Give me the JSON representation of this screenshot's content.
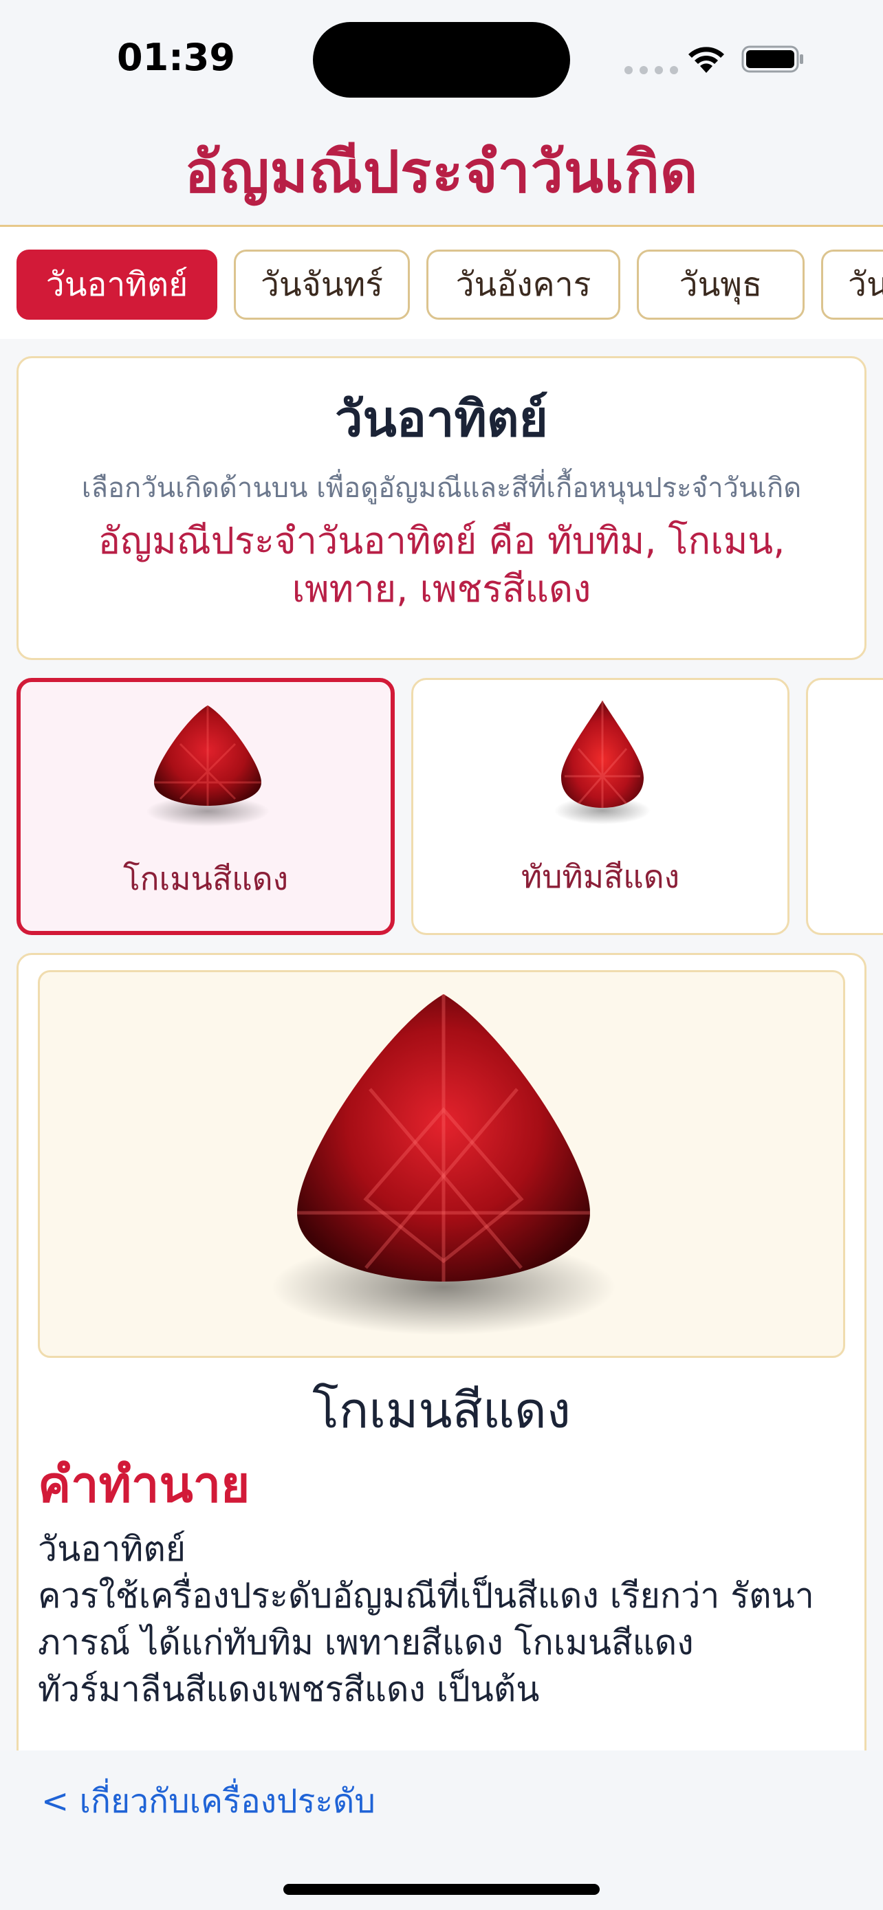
{
  "status": {
    "time": "01:39"
  },
  "header": {
    "title": "อัญมณีประจำวันเกิด"
  },
  "day_tabs": [
    {
      "label": "วันอาทิตย์",
      "active": true
    },
    {
      "label": "วันจันทร์",
      "active": false
    },
    {
      "label": "วันอังคาร",
      "active": false
    },
    {
      "label": "วันพุธ",
      "active": false
    },
    {
      "label": "วันพฤหัสบดี",
      "active": false
    }
  ],
  "summary": {
    "day": "วันอาทิตย์",
    "hint": "เลือกวันเกิดด้านบน เพื่อดูอัญมณีและสีที่เกื้อหนุนประจำวันเกิด",
    "gems_text": "อัญมณีประจำวันอาทิตย์ คือ ทับทิม, โกเมน, เพทาย, เพชรสีแดง"
  },
  "gem_options": [
    {
      "name": "โกเมนสีแดง",
      "selected": true,
      "icon": "trillion-red-gem-icon"
    },
    {
      "name": "ทับทิมสีแดง",
      "selected": false,
      "icon": "pear-red-gem-icon"
    },
    {
      "name": "",
      "selected": false,
      "icon": "red-gem-icon"
    }
  ],
  "detail": {
    "title": "โกเมนสีแดง",
    "prophecy_heading": "คำทำนาย",
    "prophecy_text": "วันอาทิตย์\nควรใช้เครื่องประดับอัญมณีที่เป็นสีแดง เรียกว่า รัตนาภารณ์ ได้แก่ทับทิม เพทายสีแดง โกเมนสีแดง ทัวร์มาลีนสีแดงเพชรสีแดง เป็นต้น"
  },
  "footer": {
    "back_link": "< เกี่ยวกับเครื่องประดับ"
  },
  "colors": {
    "accent": "#d21a38",
    "title": "#b81f46",
    "border": "#f0dcae",
    "link": "#1f63d6"
  }
}
